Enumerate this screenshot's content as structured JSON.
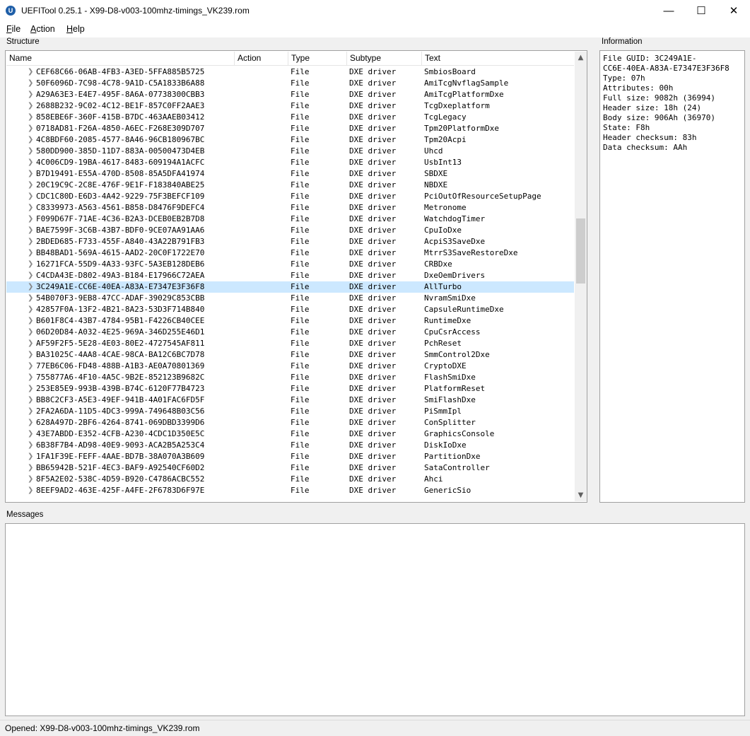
{
  "window": {
    "title": "UEFITool 0.25.1 - X99-D8-v003-100mhz-timings_VK239.rom",
    "minimize_glyph": "—",
    "maximize_glyph": "☐",
    "close_glyph": "✕"
  },
  "menu": [
    {
      "accel": "F",
      "rest": "ile"
    },
    {
      "accel": "A",
      "rest": "ction"
    },
    {
      "accel": "H",
      "rest": "elp"
    }
  ],
  "structure": {
    "label": "Structure",
    "columns": [
      "Name",
      "Action",
      "Type",
      "Subtype",
      "Text"
    ],
    "rows": [
      {
        "name": "CEF68C66-06AB-4FB3-A3ED-5FFA885B5725",
        "type": "File",
        "subtype": "DXE driver",
        "text": "SmbiosBoard"
      },
      {
        "name": "50F6096D-7C98-4C78-9A1D-C5A1833B6A88",
        "type": "File",
        "subtype": "DXE driver",
        "text": "AmiTcgNvflagSample"
      },
      {
        "name": "A29A63E3-E4E7-495F-8A6A-07738300CBB3",
        "type": "File",
        "subtype": "DXE driver",
        "text": "AmiTcgPlatformDxe"
      },
      {
        "name": "2688B232-9C02-4C12-BE1F-857C0FF2AAE3",
        "type": "File",
        "subtype": "DXE driver",
        "text": "TcgDxeplatform"
      },
      {
        "name": "858EBE6F-360F-415B-B7DC-463AAEB03412",
        "type": "File",
        "subtype": "DXE driver",
        "text": "TcgLegacy"
      },
      {
        "name": "0718AD81-F26A-4850-A6EC-F268E309D707",
        "type": "File",
        "subtype": "DXE driver",
        "text": "Tpm20PlatformDxe"
      },
      {
        "name": "4C8BDF60-2085-4577-8A46-96CB180967BC",
        "type": "File",
        "subtype": "DXE driver",
        "text": "Tpm20Acpi"
      },
      {
        "name": "580DD900-385D-11D7-883A-00500473D4EB",
        "type": "File",
        "subtype": "DXE driver",
        "text": "Uhcd"
      },
      {
        "name": "4C006CD9-19BA-4617-8483-609194A1ACFC",
        "type": "File",
        "subtype": "DXE driver",
        "text": "UsbInt13"
      },
      {
        "name": "B7D19491-E55A-470D-8508-85A5DFA41974",
        "type": "File",
        "subtype": "DXE driver",
        "text": "SBDXE"
      },
      {
        "name": "20C19C9C-2C8E-476F-9E1F-F183840ABE25",
        "type": "File",
        "subtype": "DXE driver",
        "text": "NBDXE"
      },
      {
        "name": "CDC1C80D-E6D3-4A42-9229-75F3BEFCF109",
        "type": "File",
        "subtype": "DXE driver",
        "text": "PciOutOfResourceSetupPage"
      },
      {
        "name": "C8339973-A563-4561-B858-D8476F9DEFC4",
        "type": "File",
        "subtype": "DXE driver",
        "text": "Metronome"
      },
      {
        "name": "F099D67F-71AE-4C36-B2A3-DCEB0EB2B7D8",
        "type": "File",
        "subtype": "DXE driver",
        "text": "WatchdogTimer"
      },
      {
        "name": "BAE7599F-3C6B-43B7-BDF0-9CE07AA91AA6",
        "type": "File",
        "subtype": "DXE driver",
        "text": "CpuIoDxe"
      },
      {
        "name": "2BDED685-F733-455F-A840-43A22B791FB3",
        "type": "File",
        "subtype": "DXE driver",
        "text": "AcpiS3SaveDxe"
      },
      {
        "name": "BB48BAD1-569A-4615-AAD2-20C0F1722E70",
        "type": "File",
        "subtype": "DXE driver",
        "text": "MtrrS3SaveRestoreDxe"
      },
      {
        "name": "16271FCA-55D9-4A33-93FC-5A3EB128DEB6",
        "type": "File",
        "subtype": "DXE driver",
        "text": "CRBDxe"
      },
      {
        "name": "C4CDA43E-D802-49A3-B184-E17966C72AEA",
        "type": "File",
        "subtype": "DXE driver",
        "text": "DxeOemDrivers"
      },
      {
        "name": "3C249A1E-CC6E-40EA-A83A-E7347E3F36F8",
        "type": "File",
        "subtype": "DXE driver",
        "text": "AllTurbo",
        "selected": true
      },
      {
        "name": "54B070F3-9EB8-47CC-ADAF-39029C853CBB",
        "type": "File",
        "subtype": "DXE driver",
        "text": "NvramSmiDxe"
      },
      {
        "name": "42857F0A-13F2-4B21-8A23-53D3F714B840",
        "type": "File",
        "subtype": "DXE driver",
        "text": "CapsuleRuntimeDxe"
      },
      {
        "name": "B601F8C4-43B7-4784-95B1-F4226CB40CEE",
        "type": "File",
        "subtype": "DXE driver",
        "text": "RuntimeDxe"
      },
      {
        "name": "06D20D84-A032-4E25-969A-346D255E46D1",
        "type": "File",
        "subtype": "DXE driver",
        "text": "CpuCsrAccess"
      },
      {
        "name": "AF59F2F5-5E28-4E03-80E2-4727545AF811",
        "type": "File",
        "subtype": "DXE driver",
        "text": "PchReset"
      },
      {
        "name": "BA31025C-4AA8-4CAE-98CA-BA12C6BC7D78",
        "type": "File",
        "subtype": "DXE driver",
        "text": "SmmControl2Dxe"
      },
      {
        "name": "77EB6C06-FD48-488B-A1B3-AE0A70801369",
        "type": "File",
        "subtype": "DXE driver",
        "text": "CryptoDXE"
      },
      {
        "name": "755877A6-4F10-4A5C-9B2E-852123B9682C",
        "type": "File",
        "subtype": "DXE driver",
        "text": "FlashSmiDxe"
      },
      {
        "name": "253E85E9-993B-439B-B74C-6120F77B4723",
        "type": "File",
        "subtype": "DXE driver",
        "text": "PlatformReset"
      },
      {
        "name": "BB8C2CF3-A5E3-49EF-941B-4A01FAC6FD5F",
        "type": "File",
        "subtype": "DXE driver",
        "text": "SmiFlashDxe"
      },
      {
        "name": "2FA2A6DA-11D5-4DC3-999A-749648B03C56",
        "type": "File",
        "subtype": "DXE driver",
        "text": "PiSmmIpl"
      },
      {
        "name": "628A497D-2BF6-4264-8741-069DBD3399D6",
        "type": "File",
        "subtype": "DXE driver",
        "text": "ConSplitter"
      },
      {
        "name": "43E7ABDD-E352-4CFB-A230-4CDC1D350E5C",
        "type": "File",
        "subtype": "DXE driver",
        "text": "GraphicsConsole"
      },
      {
        "name": "6B38F7B4-AD98-40E9-9093-ACA2B5A253C4",
        "type": "File",
        "subtype": "DXE driver",
        "text": "DiskIoDxe"
      },
      {
        "name": "1FA1F39E-FEFF-4AAE-BD7B-38A070A3B609",
        "type": "File",
        "subtype": "DXE driver",
        "text": "PartitionDxe"
      },
      {
        "name": "BB65942B-521F-4EC3-BAF9-A92540CF60D2",
        "type": "File",
        "subtype": "DXE driver",
        "text": "SataController"
      },
      {
        "name": "8F5A2E02-538C-4D59-B920-C4786ACBC552",
        "type": "File",
        "subtype": "DXE driver",
        "text": "Ahci"
      },
      {
        "name": "8EEF9AD2-463E-425F-A4FE-2F6783D6F97E",
        "type": "File",
        "subtype": "DXE driver",
        "text": "GenericSio"
      }
    ]
  },
  "information": {
    "label": "Information",
    "text": "File GUID: 3C249A1E-\nCC6E-40EA-A83A-E7347E3F36F8\nType: 07h\nAttributes: 00h\nFull size: 9082h (36994)\nHeader size: 18h (24)\nBody size: 906Ah (36970)\nState: F8h\nHeader checksum: 83h\nData checksum: AAh"
  },
  "messages": {
    "label": "Messages"
  },
  "status": {
    "text": "Opened: X99-D8-v003-100mhz-timings_VK239.rom"
  }
}
